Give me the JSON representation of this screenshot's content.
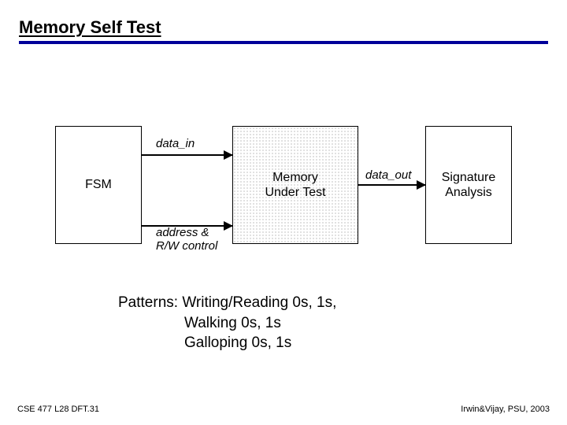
{
  "title": "Memory Self Test",
  "diagram": {
    "fsm_label": "FSM",
    "memory_label_line1": "Memory",
    "memory_label_line2": "Under Test",
    "signature_label_line1": "Signature",
    "signature_label_line2": "Analysis",
    "signal_data_in": "data_in",
    "signal_data_out": "data_out",
    "signal_addr_line1": "address &",
    "signal_addr_line2": "R/W control"
  },
  "patterns": {
    "line1": "Patterns: Writing/Reading 0s, 1s,",
    "line2": "Walking 0s, 1s",
    "line3": "Galloping 0s, 1s"
  },
  "footer": {
    "left": "CSE 477 L28 DFT.31",
    "right": "Irwin&Vijay, PSU, 2003"
  }
}
